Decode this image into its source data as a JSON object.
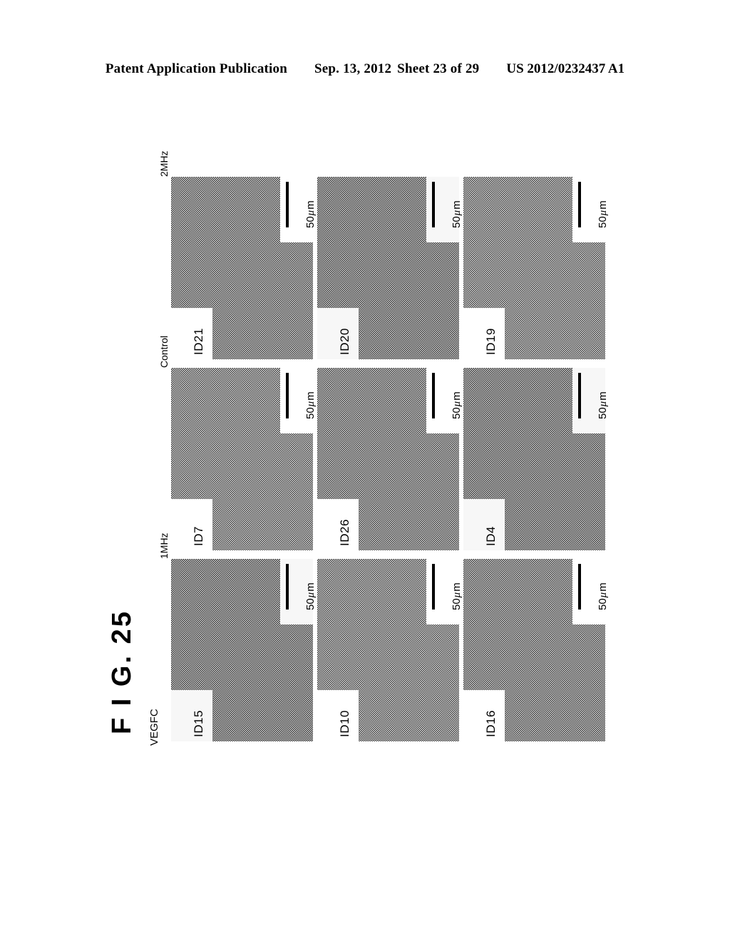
{
  "header": {
    "publication": "Patent Application Publication",
    "date": "Sep. 13, 2012",
    "sheet": "Sheet 23 of 29",
    "doc_number": "US 2012/0232437 A1"
  },
  "figure": {
    "caption": "F I G. 25",
    "group_label": "VEGFC",
    "scale_bar_value": "50",
    "scale_bar_unit_mu": "μ",
    "scale_bar_unit_m": "m",
    "columns": [
      {
        "label": "2MHz",
        "panels": [
          {
            "id": "ID21",
            "scale": "50 μ m"
          },
          {
            "id": "ID20",
            "scale": "50 μ m"
          },
          {
            "id": "ID19",
            "scale": "50 μ m"
          }
        ]
      },
      {
        "label": "Control",
        "panels": [
          {
            "id": "ID7",
            "scale": "50 μ m"
          },
          {
            "id": "ID26",
            "scale": "50 μ m"
          },
          {
            "id": "ID4",
            "scale": "50 μ m"
          }
        ]
      },
      {
        "label": "1MHz",
        "panels": [
          {
            "id": "ID15",
            "scale": "50 μ m"
          },
          {
            "id": "ID10",
            "scale": "50 μ m"
          },
          {
            "id": "ID16",
            "scale": "50 μ m"
          }
        ]
      }
    ]
  },
  "colors": {
    "ink": "#000000",
    "paper": "#ffffff",
    "micrograph_gray": "#8d8d8d"
  }
}
